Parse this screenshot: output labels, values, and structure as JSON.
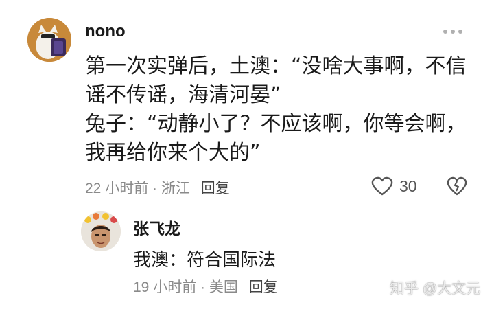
{
  "comment": {
    "username": "nono",
    "text": "第一次实弹后，土澳：“没啥大事啊，不信\n谣不传谣，海清河晏”\n兔子：“动静小了？不应该啊，你等会啊，\n我再给你来个大的”",
    "time": "22 小时前",
    "location": "浙江",
    "reply_label": "回复",
    "like_count": "30"
  },
  "reply": {
    "username": "张飞龙",
    "text": "我澳：符合国际法",
    "time": "19 小时前",
    "location": "美国",
    "reply_label": "回复"
  },
  "watermark": "知乎 @大文元",
  "colors": {
    "text": "#1a1a1a",
    "meta": "#8a8a8a",
    "icon": "#555555",
    "avatar_bg": "#c8893a"
  }
}
